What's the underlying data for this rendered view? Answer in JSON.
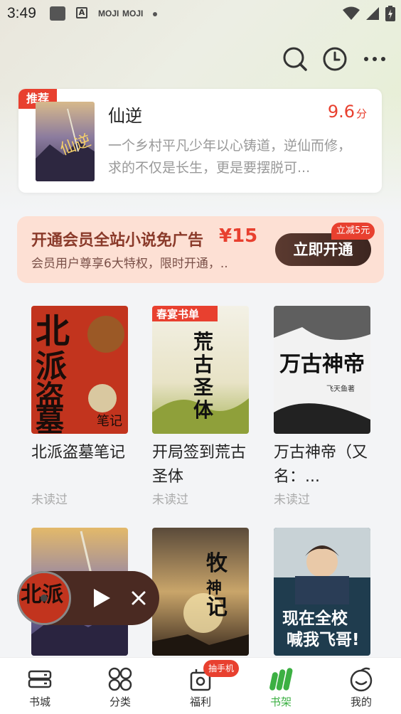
{
  "status_bar": {
    "time": "3:49",
    "notif_a": "A",
    "notif_moji_1": "MOJI",
    "notif_moji_2": "MOJI"
  },
  "toolbar": {
    "icons": [
      "search-icon",
      "history-clock-icon",
      "more-icon"
    ]
  },
  "recommend": {
    "badge": "推荐",
    "title": "仙逆",
    "score": "9.6",
    "score_unit": "分",
    "description": "一个乡村平凡少年以心铸道，逆仙而修，求的不仅是长生，更是要摆脱可..."
  },
  "vip_banner": {
    "title": "开通会员全站小说免广告",
    "price": "¥15",
    "subtitle": "会员用户尊享6大特权，限时开通，..",
    "button_label": "立即开通",
    "discount_tag": "立减5元"
  },
  "books": [
    {
      "title": "北派盗墓笔记",
      "status": "未读过",
      "cover_text": "北派盗墓"
    },
    {
      "title": "开局签到荒古圣体",
      "status": "未读过",
      "cover_text": "荒古圣体",
      "cover_tag": "春宴书单"
    },
    {
      "title": "万古神帝（又名：...",
      "status": "未读过",
      "cover_text": "万古神帝",
      "cover_author": "飞天鱼著"
    },
    {
      "title": "",
      "status": "",
      "cover_text": ""
    },
    {
      "title": "",
      "status": "",
      "cover_text": "牧神记"
    },
    {
      "title": "",
      "status": "",
      "cover_text": "现在全校喊我飞哥!"
    }
  ],
  "player": {
    "state": "paused"
  },
  "bottom_nav": {
    "items": [
      {
        "label": "书城",
        "icon": "bookstore-icon"
      },
      {
        "label": "分类",
        "icon": "category-icon"
      },
      {
        "label": "福利",
        "icon": "welfare-icon",
        "badge": "抽手机"
      },
      {
        "label": "书架",
        "icon": "bookshelf-icon",
        "active": true
      },
      {
        "label": "我的",
        "icon": "profile-icon"
      }
    ]
  },
  "colors": {
    "accent_red": "#e8402f",
    "accent_green": "#3cb043",
    "vip_bg": "#fde0d4",
    "vip_button": "#4a2a22"
  }
}
